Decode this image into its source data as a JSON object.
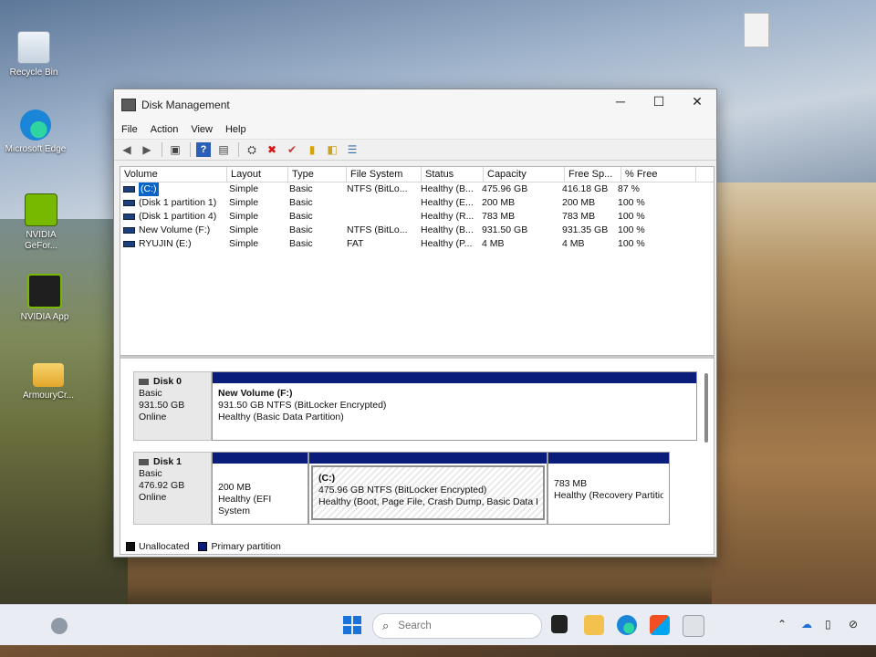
{
  "desktop": {
    "icons": [
      {
        "label": "Recycle Bin"
      },
      {
        "label": "Microsoft Edge"
      },
      {
        "label": "NVIDIA GeFor..."
      },
      {
        "label": "NVIDIA App"
      },
      {
        "label": "ArmouryCr..."
      }
    ]
  },
  "window": {
    "title": "Disk Management",
    "controls": {
      "minimize": "─",
      "maximize": "☐",
      "close": "✕"
    },
    "menu": [
      "File",
      "Action",
      "View",
      "Help"
    ],
    "toolbar": [
      {
        "icon": "back-arrow-icon",
        "glyph": "◀"
      },
      {
        "icon": "forward-arrow-icon",
        "glyph": "▶"
      },
      {
        "icon": "up-folder-icon",
        "glyph": "▣"
      },
      {
        "icon": "help-icon",
        "glyph": "?"
      },
      {
        "icon": "properties-icon",
        "glyph": "▤"
      },
      {
        "icon": "connect-disk-icon",
        "glyph": "⛭"
      },
      {
        "icon": "delete-icon",
        "glyph": "✖"
      },
      {
        "icon": "check-icon",
        "glyph": "✔"
      },
      {
        "icon": "rescan-icon",
        "glyph": "▮"
      },
      {
        "icon": "search-folder-icon",
        "glyph": "◧"
      },
      {
        "icon": "list-view-icon",
        "glyph": "☰"
      }
    ]
  },
  "volume_table": {
    "columns": [
      "Volume",
      "Layout",
      "Type",
      "File System",
      "Status",
      "Capacity",
      "Free Sp...",
      "% Free"
    ],
    "rows": [
      {
        "volume": "(C:)",
        "layout": "Simple",
        "type": "Basic",
        "fs": "NTFS (BitLo...",
        "status": "Healthy (B...",
        "capacity": "475.96 GB",
        "free": "416.18 GB",
        "pct": "87 %"
      },
      {
        "volume": "(Disk 1 partition 1)",
        "layout": "Simple",
        "type": "Basic",
        "fs": "",
        "status": "Healthy (E...",
        "capacity": "200 MB",
        "free": "200 MB",
        "pct": "100 %"
      },
      {
        "volume": "(Disk 1 partition 4)",
        "layout": "Simple",
        "type": "Basic",
        "fs": "",
        "status": "Healthy (R...",
        "capacity": "783 MB",
        "free": "783 MB",
        "pct": "100 %"
      },
      {
        "volume": "New Volume (F:)",
        "layout": "Simple",
        "type": "Basic",
        "fs": "NTFS (BitLo...",
        "status": "Healthy (B...",
        "capacity": "931.50 GB",
        "free": "931.35 GB",
        "pct": "100 %"
      },
      {
        "volume": "RYUJIN (E:)",
        "layout": "Simple",
        "type": "Basic",
        "fs": "FAT",
        "status": "Healthy (P...",
        "capacity": "4 MB",
        "free": "4 MB",
        "pct": "100 %"
      }
    ]
  },
  "disks": [
    {
      "name": "Disk 0",
      "type": "Basic",
      "size": "931.50 GB",
      "state": "Online",
      "partitions": [
        {
          "title": "New Volume  (F:)",
          "line1": "931.50 GB NTFS (BitLocker Encrypted)",
          "line2": "Healthy (Basic Data Partition)"
        }
      ]
    },
    {
      "name": "Disk 1",
      "type": "Basic",
      "size": "476.92 GB",
      "state": "Online",
      "partitions": [
        {
          "title": "",
          "line1": "200 MB",
          "line2": "Healthy (EFI System"
        },
        {
          "title": "(C:)",
          "line1": "475.96 GB NTFS (BitLocker Encrypted)",
          "line2": "Healthy (Boot, Page File, Crash Dump, Basic Data Partit"
        },
        {
          "title": "",
          "line1": "783 MB",
          "line2": "Healthy (Recovery Partitior"
        }
      ]
    }
  ],
  "legend": [
    {
      "label": "Unallocated",
      "color": "#111111"
    },
    {
      "label": "Primary partition",
      "color": "#0b1d7a"
    }
  ],
  "taskbar": {
    "search_placeholder": "Search"
  },
  "colors": {
    "partition_bar": "#0b1d7a",
    "selection": "#0a64c8"
  }
}
